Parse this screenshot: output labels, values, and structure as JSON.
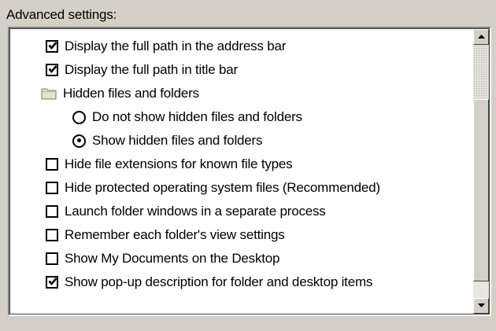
{
  "section_label": "Advanced settings:",
  "items": [
    {
      "type": "checkbox",
      "label": "Display the full path in the address bar",
      "checked": true
    },
    {
      "type": "checkbox",
      "label": "Display the full path in title bar",
      "checked": true
    },
    {
      "type": "folder",
      "label": "Hidden files and folders",
      "icon": "folder-icon"
    },
    {
      "type": "radio",
      "label": "Do not show hidden files and folders",
      "checked": false
    },
    {
      "type": "radio",
      "label": "Show hidden files and folders",
      "checked": true
    },
    {
      "type": "checkbox",
      "label": "Hide file extensions for known file types",
      "checked": false
    },
    {
      "type": "checkbox",
      "label": "Hide protected operating system files (Recommended)",
      "checked": false
    },
    {
      "type": "checkbox",
      "label": "Launch folder windows in a separate process",
      "checked": false
    },
    {
      "type": "checkbox",
      "label": "Remember each folder's view settings",
      "checked": false
    },
    {
      "type": "checkbox",
      "label": "Show My Documents on the Desktop",
      "checked": false
    },
    {
      "type": "checkbox",
      "label": "Show pop-up description for folder and desktop items",
      "checked": true
    }
  ],
  "scrollbar": {
    "up_icon": "arrow-up-icon",
    "down_icon": "arrow-down-icon"
  },
  "colors": {
    "window_background": "#d4d0c8",
    "list_background": "#ffffff",
    "text": "#000000"
  }
}
